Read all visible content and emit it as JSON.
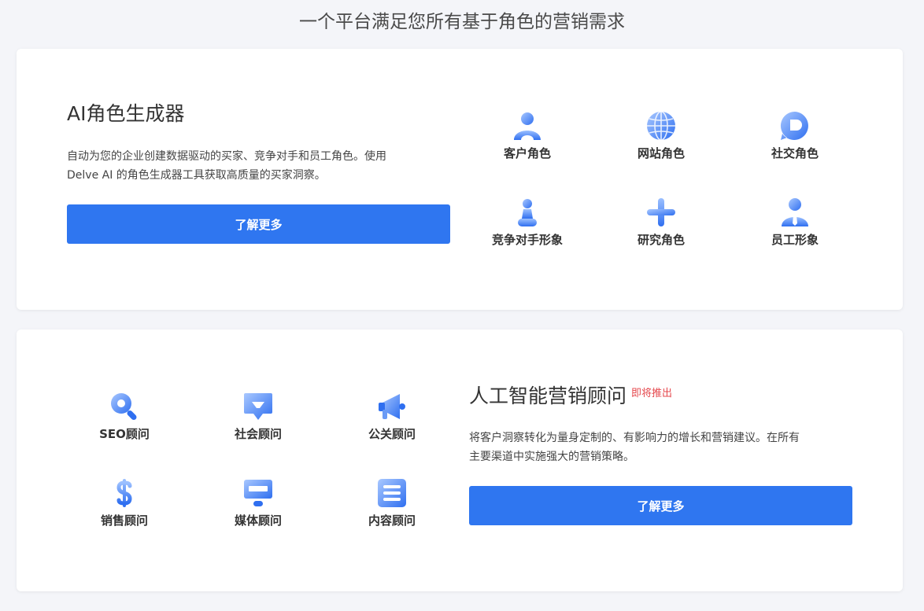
{
  "page": {
    "title": "一个平台满足您所有基于角色的营销需求"
  },
  "persona_generator": {
    "title": "AI角色生成器",
    "description_line1": "自动为您的企业创建数据驱动的买家、竞争对手和员工角色。使用",
    "description_line2": "Delve AI 的角色生成器工具获取高质量的买家洞察。",
    "button_label": "了解更多",
    "items": [
      {
        "label": "客户角色",
        "icon": "person-icon"
      },
      {
        "label": "网站角色",
        "icon": "globe-icon"
      },
      {
        "label": "社交角色",
        "icon": "chat-bubble-icon"
      },
      {
        "label": "竞争对手形象",
        "icon": "chess-pawn-icon"
      },
      {
        "label": "研究角色",
        "icon": "plus-icon"
      },
      {
        "label": "员工形象",
        "icon": "employee-tie-icon"
      }
    ]
  },
  "marketing_advisor": {
    "title": "人工智能营销顾问",
    "badge": "即将推出",
    "description_line1": "将客户洞察转化为量身定制的、有影响力的增长和营销建议。在所有",
    "description_line2": "主要渠道中实施强大的营销策略。",
    "button_label": "了解更多",
    "items": [
      {
        "label": "SEO顾问",
        "icon": "search-icon"
      },
      {
        "label": "社会顾问",
        "icon": "message-icon"
      },
      {
        "label": "公关顾问",
        "icon": "megaphone-icon"
      },
      {
        "label": "销售顾问",
        "icon": "dollar-icon"
      },
      {
        "label": "媒体顾问",
        "icon": "monitor-icon"
      },
      {
        "label": "内容顾问",
        "icon": "document-lines-icon"
      }
    ]
  },
  "colors": {
    "accent": "#2f76f0",
    "badge": "#e5484d",
    "icon_dark": "#2f6ff0",
    "icon_light": "#a9c8ff"
  }
}
